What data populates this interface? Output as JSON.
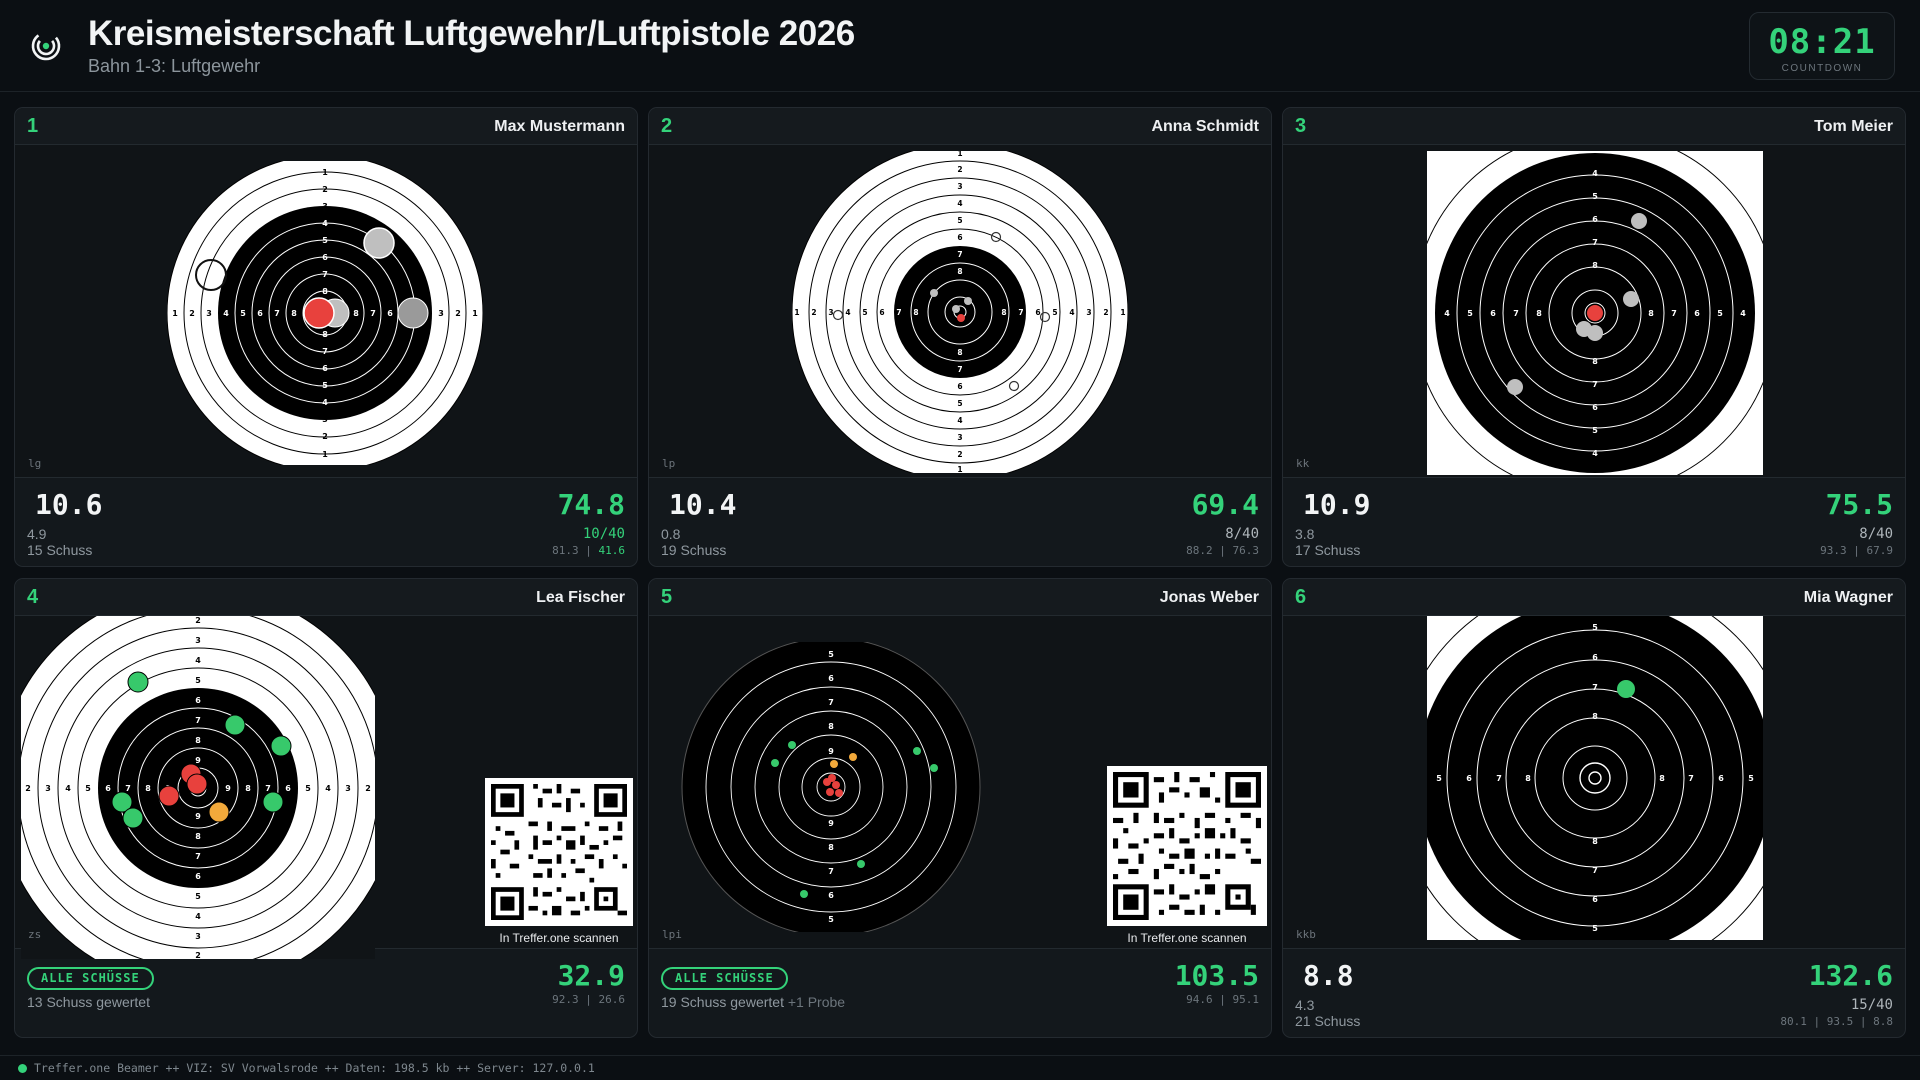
{
  "header": {
    "title": "Kreismeisterschaft Luftgewehr/Luftpistole 2026",
    "subtitle": "Bahn 1-3: Luftgewehr",
    "countdown": "08:21",
    "countdown_label": "COUNTDOWN"
  },
  "lanes": [
    {
      "number": "1",
      "name": "Max Mustermann",
      "target_code": "lg",
      "last_shot": "10.6",
      "last_sub": "4.9",
      "shots": "15 Schuss",
      "total": "74.8",
      "progress": "10/40",
      "series_a": "81.3",
      "series_b": "41.6"
    },
    {
      "number": "2",
      "name": "Anna Schmidt",
      "target_code": "lp",
      "last_shot": "10.4",
      "last_sub": "0.8",
      "shots": "19 Schuss",
      "total": "69.4",
      "progress": "8/40",
      "series": "88.2 | 76.3"
    },
    {
      "number": "3",
      "name": "Tom Meier",
      "target_code": "kk",
      "last_shot": "10.9",
      "last_sub": "3.8",
      "shots": "17 Schuss",
      "total": "75.5",
      "progress": "8/40",
      "series": "93.3 | 67.9"
    },
    {
      "number": "4",
      "name": "Lea Fischer",
      "target_code": "zs",
      "badge": "ALLE SCHÜSSE",
      "counted": "13 Schuss gewertet",
      "total": "32.9",
      "series": "92.3 | 26.6",
      "qr_label": "In Treffer.one scannen"
    },
    {
      "number": "5",
      "name": "Jonas Weber",
      "target_code": "lpi",
      "badge": "ALLE SCHÜSSE",
      "counted": "19 Schuss gewertet",
      "probe": "+1 Probe",
      "total": "103.5",
      "series": "94.6 | 95.1",
      "qr_label": "In Treffer.one scannen"
    },
    {
      "number": "6",
      "name": "Mia Wagner",
      "target_code": "kkb",
      "last_shot": "8.8",
      "last_sub": "4.3",
      "shots": "21 Schuss",
      "total": "132.6",
      "progress": "15/40",
      "series": "80.1 | 93.5 | 8.8"
    }
  ],
  "footer": {
    "status": "Treffer.one Beamer ++ VIZ: SV Vorwalsrode ++ Daten: 198.5 kb ++ Server: 127.0.0.1"
  },
  "colors": {
    "accent": "#34d27a",
    "hit_red": "#e8413d",
    "hit_green": "#37c96b",
    "hit_orange": "#f2a93b",
    "hit_gray": "#bfbfbf"
  }
}
